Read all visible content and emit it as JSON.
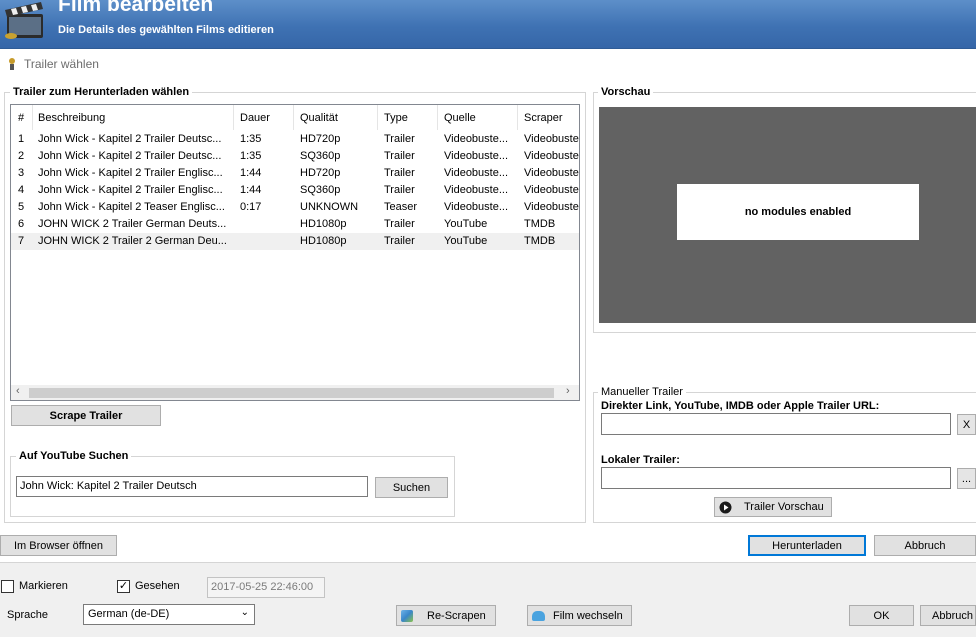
{
  "header": {
    "title": "Film bearbeiten",
    "subtitle": "Die Details des gewählten Films editieren"
  },
  "tab": {
    "label": "Trailer wählen"
  },
  "trailer_group": {
    "title": "Trailer zum Herunterladen wählen",
    "columns": [
      "#",
      "Beschreibung",
      "Dauer",
      "Qualität",
      "Type",
      "Quelle",
      "Scraper"
    ],
    "rows": [
      {
        "num": "1",
        "desc": "John Wick - Kapitel 2 Trailer Deutsc...",
        "dauer": "1:35",
        "qual": "HD720p",
        "type": "Trailer",
        "quelle": "Videobuste...",
        "scraper": "Videobuste"
      },
      {
        "num": "2",
        "desc": "John Wick - Kapitel 2 Trailer Deutsc...",
        "dauer": "1:35",
        "qual": "SQ360p",
        "type": "Trailer",
        "quelle": "Videobuste...",
        "scraper": "Videobuste"
      },
      {
        "num": "3",
        "desc": "John Wick - Kapitel 2 Trailer Englisc...",
        "dauer": "1:44",
        "qual": "HD720p",
        "type": "Trailer",
        "quelle": "Videobuste...",
        "scraper": "Videobuste"
      },
      {
        "num": "4",
        "desc": "John Wick - Kapitel 2 Trailer Englisc...",
        "dauer": "1:44",
        "qual": "SQ360p",
        "type": "Trailer",
        "quelle": "Videobuste...",
        "scraper": "Videobuste"
      },
      {
        "num": "5",
        "desc": "John Wick - Kapitel 2 Teaser Englisc...",
        "dauer": "0:17",
        "qual": "UNKNOWN",
        "type": "Teaser",
        "quelle": "Videobuste...",
        "scraper": "Videobuste"
      },
      {
        "num": "6",
        "desc": "JOHN WICK 2 Trailer German Deuts...",
        "dauer": "",
        "qual": "HD1080p",
        "type": "Trailer",
        "quelle": "YouTube",
        "scraper": "TMDB"
      },
      {
        "num": "7",
        "desc": "JOHN WICK 2 Trailer 2 German Deu...",
        "dauer": "",
        "qual": "HD1080p",
        "type": "Trailer",
        "quelle": "YouTube",
        "scraper": "TMDB"
      }
    ],
    "scrape_button": "Scrape Trailer"
  },
  "youtube_group": {
    "title": "Auf YouTube Suchen",
    "query": "John Wick: Kapitel 2 Trailer Deutsch",
    "search_button": "Suchen"
  },
  "preview_group": {
    "title": "Vorschau",
    "message": "no modules enabled"
  },
  "manual_group": {
    "title": "Manueller Trailer",
    "url_label": "Direkter Link, YouTube, IMDB oder Apple Trailer URL:",
    "url_value": "",
    "clear_button": "X",
    "local_label": "Lokaler Trailer:",
    "local_value": "",
    "browse_button": "...",
    "preview_button": "Trailer Vorschau"
  },
  "actions": {
    "browser_button": "Im Browser öffnen",
    "download_button": "Herunterladen",
    "cancel_button": "Abbruch"
  },
  "footer": {
    "mark_label": "Markieren",
    "mark_checked": false,
    "seen_label": "Gesehen",
    "seen_checked": true,
    "seen_date": "2017-05-25 22:46:00",
    "language_label": "Sprache",
    "language_value": "German (de-DE)",
    "rescrape_button": "Re-Scrapen",
    "change_film_button": "Film wechseln",
    "ok_button": "OK",
    "cancel_button": "Abbruch"
  },
  "colors": {
    "header": "#3f72b3",
    "accent": "#0078d7",
    "preview_bg": "#626262"
  }
}
